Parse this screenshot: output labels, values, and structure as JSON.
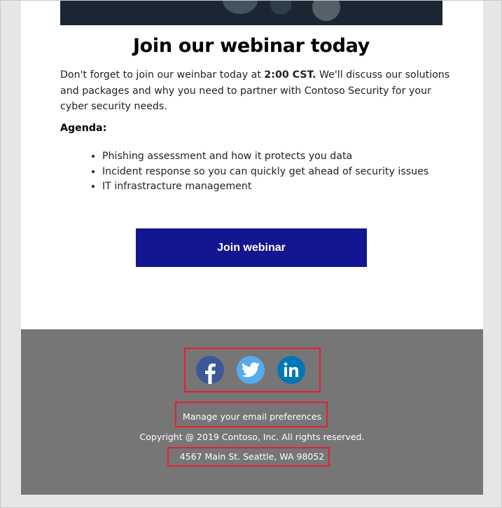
{
  "email": {
    "heading": "Join our webinar today",
    "body_part1": "Don't forget to join our weinbar today at ",
    "body_bold": "2:00 CST.",
    "body_part2": " We'll discuss our solutions and packages and why you need to partner with Contoso Security for your cyber security needs.",
    "agenda_label": "Agenda:",
    "agenda_items": [
      "Phishing assessment and how it protects you data",
      "Incident response so you can quickly get ahead of security issues",
      "IT infrastracture management"
    ],
    "cta_label": "Join webinar"
  },
  "footer": {
    "social_icons": [
      "facebook-icon",
      "twitter-icon",
      "linkedin-icon"
    ],
    "manage_preferences": "Manage your email preferences",
    "copyright": "Copyright @ 2019 Contoso, Inc. All rights reserved.",
    "address": "4567 Main St. Seattle, WA 98052"
  },
  "colors": {
    "button": "#131690",
    "footer_bg": "#767676",
    "highlight": "#e5202d",
    "facebook": "#3b5998",
    "twitter": "#55acee",
    "linkedin": "#0077b5"
  }
}
